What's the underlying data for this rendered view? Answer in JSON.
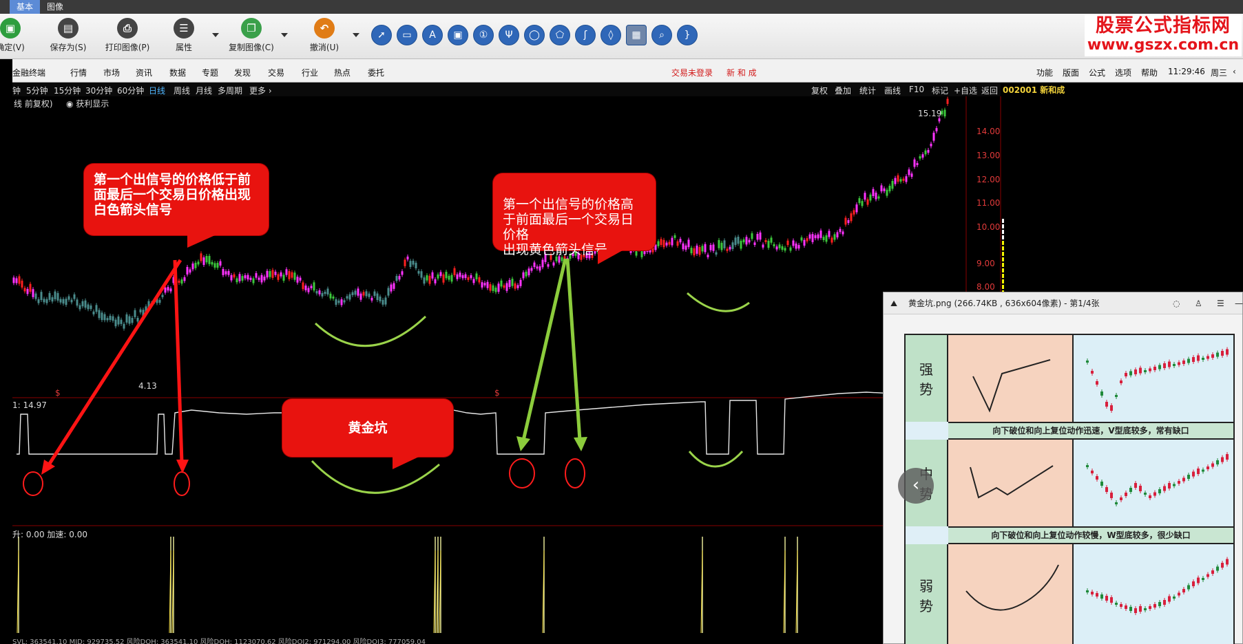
{
  "window_tabs": [
    "基本",
    "图像"
  ],
  "toolbar": {
    "buttons": [
      {
        "label": "确定(V)",
        "icon": "save-check-icon"
      },
      {
        "label": "保存为(S)",
        "icon": "save-as-icon"
      },
      {
        "label": "打印图像(P)",
        "icon": "print-icon"
      },
      {
        "label": "属性",
        "icon": "list-icon"
      },
      {
        "label": "复制图像(C)",
        "icon": "copy-image-icon"
      },
      {
        "label": "撤消(U)",
        "icon": "undo-icon"
      }
    ],
    "tools": [
      "arrow-tool-icon",
      "rectangle-tool-icon",
      "text-tool-icon",
      "callout-tool-icon",
      "number-tool-icon",
      "marker-tool-icon",
      "ellipse-tool-icon",
      "polygon-tool-icon",
      "curve-tool-icon",
      "blur-tool-icon",
      "mosaic-tool-icon",
      "zoom-tool-icon",
      "brace-tool-icon"
    ],
    "brand_line1": "股票公式指标网",
    "brand_line2": "www.gszx.com.cn"
  },
  "menubar": {
    "left_items": [
      "金融终端",
      "行情",
      "市场",
      "资讯",
      "数据",
      "专题",
      "发现",
      "交易",
      "行业",
      "热点",
      "委托"
    ],
    "login_status": "交易未登录",
    "stock_short": "新 和 成",
    "right_items": [
      "功能",
      "版面",
      "公式",
      "选项",
      "帮助"
    ],
    "time": "11:29:46",
    "weekday": "周三"
  },
  "periods": {
    "items": [
      "钟",
      "5分钟",
      "15分钟",
      "30分钟",
      "60分钟",
      "日线",
      "周线",
      "月线",
      "多周期",
      "更多 ›"
    ],
    "current": "日线",
    "right_items": [
      "复权",
      "叠加",
      "统计",
      "画线",
      "F10",
      "标记",
      "+自选",
      "返回"
    ],
    "stock_code_name": "002001 新和成"
  },
  "chart": {
    "subtitle": "线 前复权)",
    "profit_toggle": "获利显示",
    "high_label": "15.19",
    "low_label": "4.13",
    "indicator1_label": "1: 14.97",
    "indicator2_label": "升: 0.00  加速: 0.00",
    "signal_marker": "$",
    "price_ticks": [
      "14.00",
      "13.00",
      "12.00",
      "11.00",
      "10.00",
      "9.00",
      "8.00"
    ],
    "bottom_text": "SVL: 363541.10  MID: 929735.52  风险DOH: 363541.10  风险DOH: 1123070.62  风险DOI2: 971294.00  风险DOI3: 777059.04"
  },
  "callouts": {
    "left": "第一个出信号的价格低于前面最后一个交易日价格出现白色箭头信号",
    "right": "第一个出信号的价格高于前面最后一个交易日价格\n出现黄色箭头信号",
    "pit": "黄金坑"
  },
  "viewer": {
    "title": "黄金坑.png (266.74KB , 636x604像素) - 第1/4张",
    "rows": [
      {
        "label_top": "强",
        "label_bottom": "势",
        "caption": "向下破位和向上复位动作迅速，V型底较多，常有缺口"
      },
      {
        "label_top": "中",
        "label_bottom": "势",
        "caption": "向下破位和向上复位动作较慢，W型底较多，很少缺口"
      },
      {
        "label_top": "弱",
        "label_bottom": "势",
        "caption": ""
      }
    ]
  },
  "colors": {
    "up_magenta": "#ff33ff",
    "down_red": "#ff2020",
    "neutral_teal": "#4a8c8c",
    "green": "#3cc83c",
    "callout_red": "#e8130f",
    "annotation_green": "#9ad34a",
    "profit_yellow": "#f5f500"
  }
}
